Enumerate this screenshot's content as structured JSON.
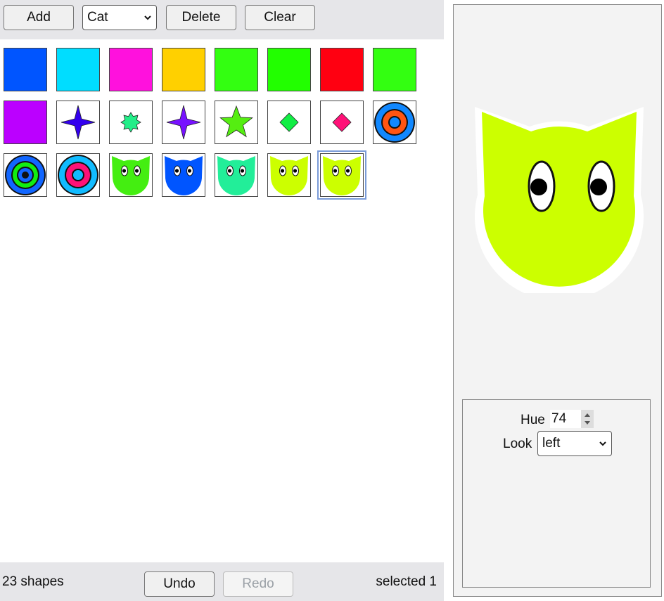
{
  "toolbar": {
    "add_label": "Add",
    "shape_select_value": "Cat",
    "delete_label": "Delete",
    "clear_label": "Clear"
  },
  "status": {
    "count_text": "23 shapes",
    "undo_label": "Undo",
    "redo_label": "Redo",
    "selected_text": "selected 1"
  },
  "inspector": {
    "hue_label": "Hue",
    "hue_value": "74",
    "look_label": "Look",
    "look_value": "left"
  },
  "shapes": [
    {
      "kind": "square",
      "color": "#0055ff"
    },
    {
      "kind": "square",
      "color": "#00ddff"
    },
    {
      "kind": "square",
      "color": "#ff11dd"
    },
    {
      "kind": "square",
      "color": "#ffd000"
    },
    {
      "kind": "square",
      "color": "#33ff11"
    },
    {
      "kind": "square",
      "color": "#22ff00"
    },
    {
      "kind": "square",
      "color": "#ff0011"
    },
    {
      "kind": "square",
      "color": "#33ff11"
    },
    {
      "kind": "square",
      "color": "#bb00ff"
    },
    {
      "kind": "star4",
      "color": "#3300ee"
    },
    {
      "kind": "burst",
      "color": "#22ee88"
    },
    {
      "kind": "star4",
      "color": "#7711ff"
    },
    {
      "kind": "star5",
      "color": "#55ee11"
    },
    {
      "kind": "diamond",
      "color": "#11ee44"
    },
    {
      "kind": "diamond",
      "color": "#ff1177"
    },
    {
      "kind": "target",
      "color": "#ff5511",
      "ring": "#1188ff"
    },
    {
      "kind": "target3",
      "color": "#11ee11",
      "ring": "#1166ff"
    },
    {
      "kind": "target",
      "color": "#ff1177",
      "ring": "#11bbff"
    },
    {
      "kind": "cat",
      "color": "#44ee11"
    },
    {
      "kind": "cat",
      "color": "#0055ff"
    },
    {
      "kind": "cat",
      "color": "#22ee99"
    },
    {
      "kind": "cat",
      "color": "#ccff00"
    },
    {
      "kind": "cat",
      "color": "#ccff00",
      "selected": true
    }
  ],
  "preview": {
    "kind": "cat",
    "color": "#ccff00",
    "look": "left"
  }
}
